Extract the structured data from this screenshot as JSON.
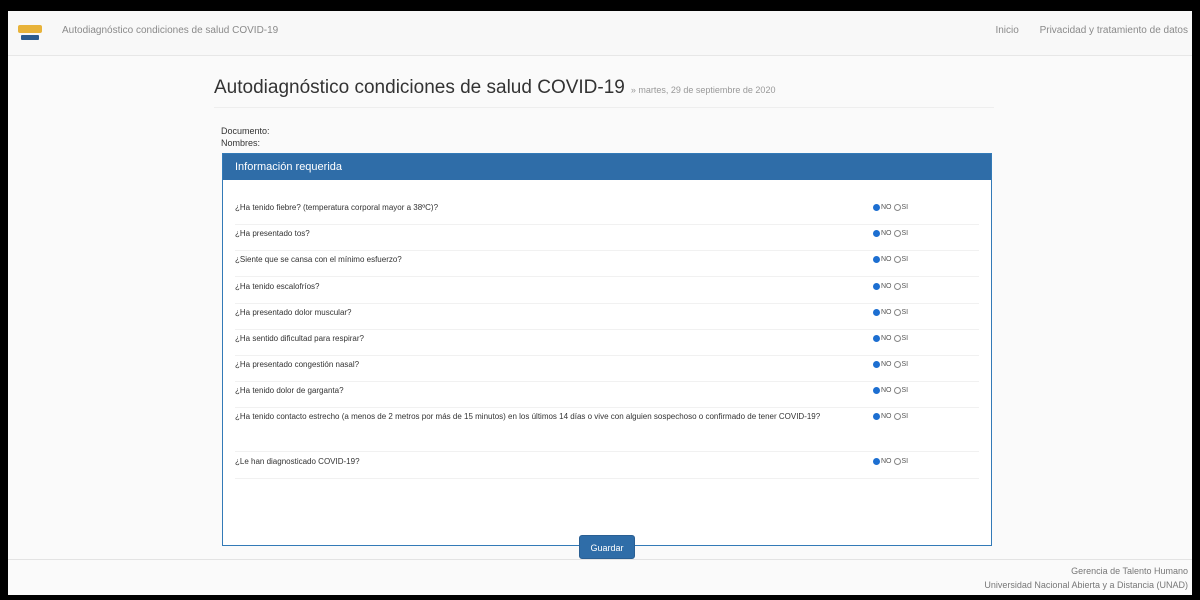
{
  "navbar": {
    "brand": "Autodiagnóstico condiciones de salud COVID-19",
    "links": [
      "Inicio",
      "Privacidad y tratamiento de datos"
    ]
  },
  "page": {
    "title": "Autodiagnóstico condiciones de salud COVID-19",
    "subtitle": "» martes, 29 de septiembre de 2020",
    "documento_label": "Documento:",
    "nombres_label": "Nombres:"
  },
  "panel": {
    "heading": "Información requerida",
    "option_no": "NO",
    "option_si": "SI",
    "questions": [
      {
        "text": "¿Ha tenido fiebre? (temperatura corporal mayor a 38ºC)?",
        "selected": "NO"
      },
      {
        "text": "¿Ha presentado tos?",
        "selected": "NO"
      },
      {
        "text": "¿Siente que se cansa con el mínimo esfuerzo?",
        "selected": "NO"
      },
      {
        "text": "¿Ha tenido escalofríos?",
        "selected": "NO"
      },
      {
        "text": "¿Ha presentado dolor muscular?",
        "selected": "NO"
      },
      {
        "text": "¿Ha sentido dificultad para respirar?",
        "selected": "NO"
      },
      {
        "text": "¿Ha presentado congestión nasal?",
        "selected": "NO"
      },
      {
        "text": "¿Ha tenido dolor de garganta?",
        "selected": "NO"
      },
      {
        "text": "¿Ha tenido contacto estrecho (a menos de 2 metros por más de 15 minutos) en los últimos 14 días o vive con alguien sospechoso o confirmado de tener COVID-19?",
        "selected": "NO"
      },
      {
        "text": "¿Le han diagnosticado COVID-19?",
        "selected": "NO"
      }
    ],
    "save_label": "Guardar"
  },
  "footer": {
    "line1": "Gerencia de Talento Humano",
    "line2": "Universidad Nacional Abierta y a Distancia (UNAD)"
  },
  "colors": {
    "primary": "#2f6da8",
    "logo_accent": "#e8b33a"
  },
  "icons": {
    "logo": "unad-logo-icon"
  }
}
